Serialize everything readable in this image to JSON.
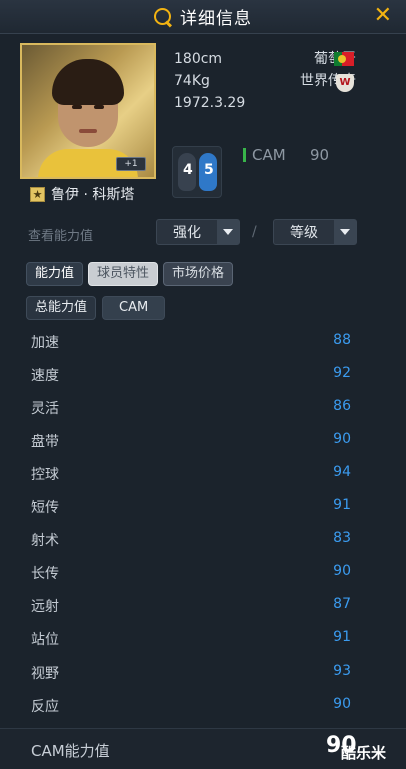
{
  "header": {
    "title": "详细信息",
    "close_icon": "close-icon",
    "accent": "#f2b312"
  },
  "player": {
    "name": "鲁伊 · 科斯塔",
    "card_tag": "+1",
    "height": "180cm",
    "weight": "74Kg",
    "birthdate": "1972.3.29",
    "nationality": "葡萄牙",
    "season": "世界传奇",
    "weak_foot": "4",
    "strong_foot": "5",
    "position": "CAM",
    "position_rating": "90"
  },
  "view": {
    "label": "查看能力值",
    "enhance_select": "强化",
    "level_select": "等级",
    "separator": "/"
  },
  "tabs": [
    {
      "label": "能力值"
    },
    {
      "label": "球员特性"
    },
    {
      "label": "市场价格"
    }
  ],
  "subtabs": [
    {
      "label": "总能力值"
    },
    {
      "label": "CAM"
    }
  ],
  "stats": [
    {
      "name": "加速",
      "value": "88"
    },
    {
      "name": "速度",
      "value": "92"
    },
    {
      "name": "灵活",
      "value": "86"
    },
    {
      "name": "盘带",
      "value": "90"
    },
    {
      "name": "控球",
      "value": "94"
    },
    {
      "name": "短传",
      "value": "91"
    },
    {
      "name": "射术",
      "value": "83"
    },
    {
      "name": "长传",
      "value": "90"
    },
    {
      "name": "远射",
      "value": "87"
    },
    {
      "name": "站位",
      "value": "91"
    },
    {
      "name": "视野",
      "value": "93"
    },
    {
      "name": "反应",
      "value": "90"
    }
  ],
  "footer": {
    "label": "CAM能力值",
    "value": "90",
    "watermark": "酷乐米"
  }
}
